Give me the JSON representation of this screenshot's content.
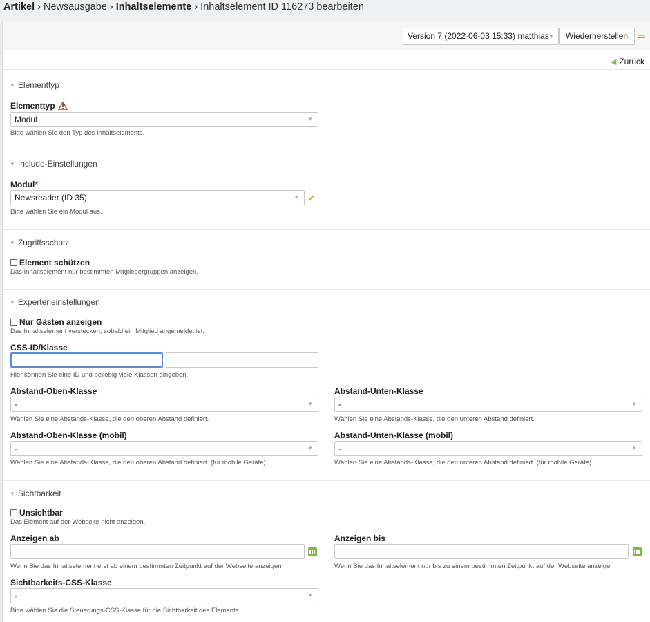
{
  "breadcrumb": {
    "items": [
      "Artikel",
      "Newsausgabe",
      "Inhaltselemente",
      "Inhaltselement ID 116273 bearbeiten"
    ],
    "separator": "›"
  },
  "toolbar": {
    "version_value": "Version 7 (2022-06-03 15:33) matthias",
    "restore_label": "Wiederherstellen"
  },
  "back": {
    "label": "Zurück"
  },
  "sections": {
    "elementtyp": {
      "legend": "Elementtyp",
      "label": "Elementtyp",
      "value": "Modul",
      "help": "Bitte wählen Sie den Typ des Inhaltselements."
    },
    "include": {
      "legend": "Include-Einstellungen",
      "label": "Modul",
      "required_mark": "*",
      "value": "Newsreader (ID 35)",
      "help": "Bitte wählen Sie ein Modul aus."
    },
    "zugriff": {
      "legend": "Zugriffsschutz",
      "checkbox_label": "Element schützen",
      "help": "Das Inhaltselement nur bestimmten Mitgliedergruppen anzeigen."
    },
    "experten": {
      "legend": "Experteneinstellungen",
      "guests_label": "Nur Gästen anzeigen",
      "guests_help": "Das Inhaltselement verstecken, sobald ein Mitglied angemeldet ist.",
      "css_label": "CSS-ID/Klasse",
      "css_id_value": "",
      "css_class_value": "",
      "css_help": "Hier können Sie eine ID und beliebig viele Klassen eingeben.",
      "top_label": "Abstand-Oben-Klasse",
      "top_value": "-",
      "top_help": "Wählen Sie eine Abstands-Klasse, die den oberen Abstand definiert.",
      "bottom_label": "Abstand-Unten-Klasse",
      "bottom_value": "-",
      "bottom_help": "Wählen Sie eine Abstands-Klasse, die den unteren Abstand definiert.",
      "top_mobile_label": "Abstand-Oben-Klasse (mobil)",
      "top_mobile_value": "-",
      "top_mobile_help": "Wählen Sie eine Abstands-Klasse, die den oberen Abstand definiert. (für mobile Geräte)",
      "bottom_mobile_label": "Abstand-Unten-Klasse (mobil)",
      "bottom_mobile_value": "-",
      "bottom_mobile_help": "Wählen Sie eine Abstands-Klasse, die den unteren Abstand definiert. (für mobile Geräte)"
    },
    "sicht": {
      "legend": "Sichtbarkeit",
      "invisible_label": "Unsichtbar",
      "invisible_help": "Das Element auf der Webseite nicht anzeigen.",
      "start_label": "Anzeigen ab",
      "start_value": "",
      "start_help": "Wenn Sie das Inhaltselement erst ab einem bestimmten Zeitpunkt auf der Webseite anzeigen",
      "stop_label": "Anzeigen bis",
      "stop_value": "",
      "stop_help": "Wenn Sie das Inhaltselement nur bis zu einem bestimmten Zeitpunkt auf der Webseite anzeigen",
      "css_label": "Sichtbarkeits-CSS-Klasse",
      "css_value": "-",
      "css_help": "Bitte wählen Sie die Steuerungs-CSS-Klasse für die Sichtbarkeit des Elements."
    }
  },
  "colors": {
    "accent": "#7fb54a",
    "focus": "#5b8ad6",
    "required": "#cc3333"
  }
}
